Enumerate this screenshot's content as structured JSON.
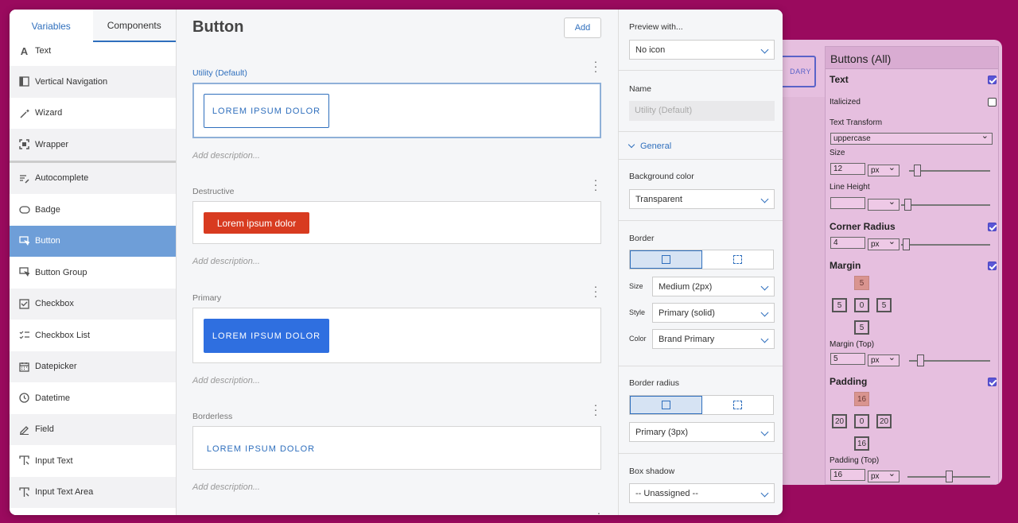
{
  "background_panel": {
    "secondary_button_text": "DARY",
    "inspector": {
      "title": "Buttons  (All)",
      "text_section": "Text",
      "italicized": "Italicized",
      "text_transform_label": "Text Transform",
      "text_transform_value": "uppercase",
      "size_label": "Size",
      "size_value": "12",
      "size_unit": "px",
      "line_height_label": "Line Height",
      "line_height_value": "",
      "corner_radius_section": "Corner Radius",
      "corner_radius_value": "4",
      "corner_radius_unit": "px",
      "margin_section": "Margin",
      "margin_top": "5",
      "margin_left": "5",
      "margin_center": "0",
      "margin_right": "5",
      "margin_bottom": "5",
      "margin_top_label": "Margin (Top)",
      "margin_top_value": "5",
      "margin_top_unit": "px",
      "padding_section": "Padding",
      "padding_top": "16",
      "padding_left": "20",
      "padding_center": "0",
      "padding_right": "20",
      "padding_bottom": "16",
      "padding_top_label": "Padding (Top)",
      "padding_top_value": "16",
      "padding_top_unit": "px"
    }
  },
  "sidebar": {
    "tabs": [
      "Variables",
      "Components"
    ],
    "items_top": [
      {
        "label": "Text",
        "icon": "text-icon"
      },
      {
        "label": "Vertical Navigation",
        "icon": "vertical-nav-icon"
      },
      {
        "label": "Wizard",
        "icon": "wand-icon"
      },
      {
        "label": "Wrapper",
        "icon": "wrapper-icon"
      }
    ],
    "items": [
      {
        "label": "Autocomplete",
        "icon": "autocomplete-icon"
      },
      {
        "label": "Badge",
        "icon": "badge-icon"
      },
      {
        "label": "Button",
        "icon": "cursor-icon",
        "selected": true
      },
      {
        "label": "Button Group",
        "icon": "cursor-icon"
      },
      {
        "label": "Checkbox",
        "icon": "checkbox-icon"
      },
      {
        "label": "Checkbox List",
        "icon": "checklist-icon"
      },
      {
        "label": "Datepicker",
        "icon": "calendar-icon"
      },
      {
        "label": "Datetime",
        "icon": "clock-icon"
      },
      {
        "label": "Field",
        "icon": "pencil-icon"
      },
      {
        "label": "Input Text",
        "icon": "input-text-icon"
      },
      {
        "label": "Input Text Area",
        "icon": "input-text-icon"
      }
    ]
  },
  "center": {
    "title": "Button",
    "add_label": "Add",
    "variants": [
      {
        "name": "Utility (Default)",
        "button_text": "LOREM IPSUM DOLOR",
        "description": "Add description...",
        "style": "utility"
      },
      {
        "name": "Destructive",
        "button_text": "Lorem ipsum dolor",
        "description": "Add description...",
        "style": "destructive"
      },
      {
        "name": "Primary",
        "button_text": "LOREM IPSUM DOLOR",
        "description": "Add description...",
        "style": "primary"
      },
      {
        "name": "Borderless",
        "button_text": "LOREM IPSUM DOLOR",
        "description": "Add description...",
        "style": "borderless"
      }
    ]
  },
  "props": {
    "preview_label": "Preview with...",
    "preview_value": "No icon",
    "name_label": "Name",
    "name_placeholder": "Utility (Default)",
    "general_label": "General",
    "bg_color_label": "Background color",
    "bg_color_value": "Transparent",
    "border_label": "Border",
    "border_size_label": "Size",
    "border_size_value": "Medium (2px)",
    "border_style_label": "Style",
    "border_style_value": "Primary (solid)",
    "border_color_label": "Color",
    "border_color_value": "Brand Primary",
    "border_radius_label": "Border radius",
    "border_radius_value": "Primary (3px)",
    "box_shadow_label": "Box shadow",
    "box_shadow_value": "-- Unassigned --"
  },
  "colors": {
    "background": "#9a0a5e",
    "accent": "#2f6fbd",
    "destructive": "#d83b20",
    "primary": "#2f6fe0",
    "selected_sidebar": "#6e9ed8"
  }
}
